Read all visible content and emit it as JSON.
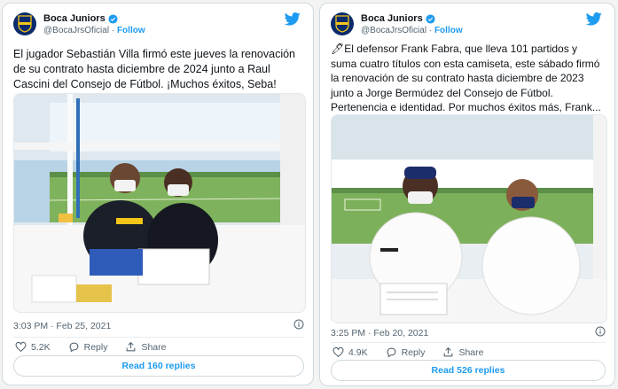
{
  "colors": {
    "accent": "#1d9bf0",
    "boca_blue": "#0a2a6b",
    "boca_gold": "#f5c518"
  },
  "tweets": [
    {
      "display_name": "Boca Juniors",
      "handle": "@BocaJrsOficial",
      "follow_label": "Follow",
      "text": "El jugador Sebastián Villa firmó este jueves la renovación de su contrato hasta diciembre de 2024 junto a Raul Cascini del Consejo de Fútbol. ¡Muchos éxitos, Seba!",
      "timestamp": "3:03 PM · Feb 25, 2021",
      "likes": "5.2K",
      "reply_label": "Reply",
      "share_label": "Share",
      "read_replies": "Read 160 replies"
    },
    {
      "display_name": "Boca Juniors",
      "handle": "@BocaJrsOficial",
      "follow_label": "Follow",
      "text": "🖊El defensor Frank Fabra, que lleva 101 partidos y suma cuatro títulos con esta camiseta, este sábado firmó la renovación de su contrato hasta diciembre de 2023 junto a Jorge Bermúdez del Consejo de Fútbol. Pertenencia e identidad. Por muchos éxitos más, Frank... 🇨🇴💙💛💙🇦🇷",
      "timestamp": "3:25 PM · Feb 20, 2021",
      "likes": "4.9K",
      "reply_label": "Reply",
      "share_label": "Share",
      "read_replies": "Read 526 replies"
    }
  ]
}
